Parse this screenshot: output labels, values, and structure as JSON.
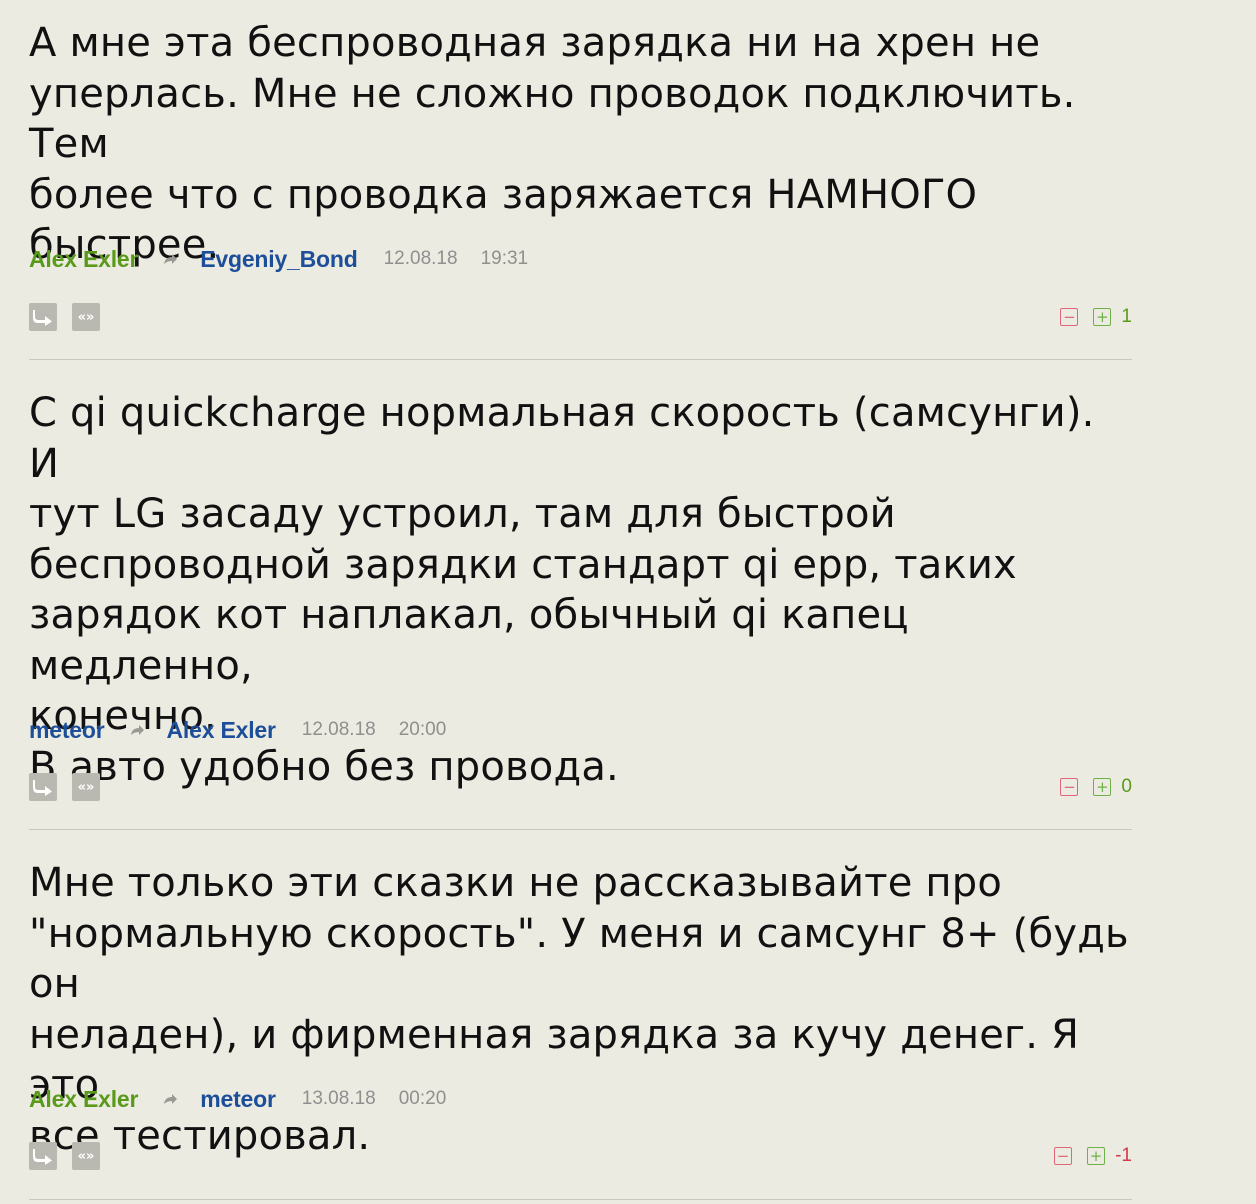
{
  "comments": [
    {
      "text": "А мне эта беспроводная зарядка ни на хрен не\nуперлась. Мне не сложно проводок подключить. Тем\nболее что с проводка заряжается НАМНОГО\nбыстрее.",
      "author": "Alex Exler",
      "reply_to": "Evgeniy_Bond",
      "date": "12.08.18",
      "time": "19:31",
      "score": "1",
      "quote_label": "«»"
    },
    {
      "text": "С qi quickcharge нормальная скорость (самсунги). И\nтут LG засаду устроил, там для быстрой\nбеспроводной зарядки стандарт qi epp, таких\nзарядок кот наплакал, обычный qi капец медленно,\nконечно.\nВ авто удобно без провода.",
      "author": "meteor",
      "reply_to": "Alex Exler",
      "date": "12.08.18",
      "time": "20:00",
      "score": "0",
      "quote_label": "«»"
    },
    {
      "text": "Мне только эти сказки не рассказывайте про\n\"нормальную скорость\". У меня и самсунг 8+ (будь он\nнеладен), и фирменная зарядка за кучу денег. Я это\nвсе тестировал.",
      "author": "Alex Exler",
      "reply_to": "meteor",
      "date": "13.08.18",
      "time": "00:20",
      "score": "-1",
      "quote_label": "«»"
    }
  ],
  "colors": {
    "background": "#ecebe1",
    "author_green": "#5a9a1b",
    "author_blue": "#1d4e9a",
    "minus_red": "#e06777",
    "plus_green": "#6fb04a"
  },
  "icons": [
    "reply-icon",
    "quote-icon",
    "reply-arrow-icon",
    "vote-down-icon",
    "vote-up-icon"
  ]
}
